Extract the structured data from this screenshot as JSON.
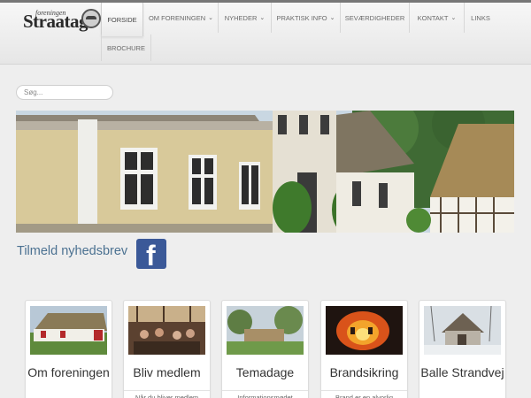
{
  "header": {
    "logo_small": "foreningen",
    "logo_main": "Straatag",
    "nav": [
      {
        "label": "Forside",
        "active": true,
        "dropdown": false
      },
      {
        "label": "Om foreningen",
        "active": false,
        "dropdown": true
      },
      {
        "label": "Nyheder",
        "active": false,
        "dropdown": true
      },
      {
        "label": "Praktisk info",
        "active": false,
        "dropdown": true
      },
      {
        "label": "Seværdigheder",
        "active": false,
        "dropdown": false
      },
      {
        "label": "Kontakt",
        "active": false,
        "dropdown": true
      },
      {
        "label": "Links",
        "active": false,
        "dropdown": false
      },
      {
        "label": "Brochure",
        "active": false,
        "dropdown": false
      }
    ]
  },
  "search": {
    "placeholder": "Søg..."
  },
  "newsletter": {
    "label": "Tilmeld nyhedsbrev"
  },
  "facebook": {
    "glyph": "f",
    "color": "#3b5998"
  },
  "cards": [
    {
      "title": "Om foreningen",
      "excerpt": ""
    },
    {
      "title": "Bliv medlem",
      "excerpt": "Når du bliver medlem"
    },
    {
      "title": "Temadage",
      "excerpt": "Informationsmødet"
    },
    {
      "title": "Brandsikring",
      "excerpt": "Brand er en alvorlig"
    },
    {
      "title": "Balle Strandvej",
      "excerpt": ""
    }
  ],
  "colors": {
    "accent": "#4b7191",
    "facebook": "#3b5998"
  }
}
